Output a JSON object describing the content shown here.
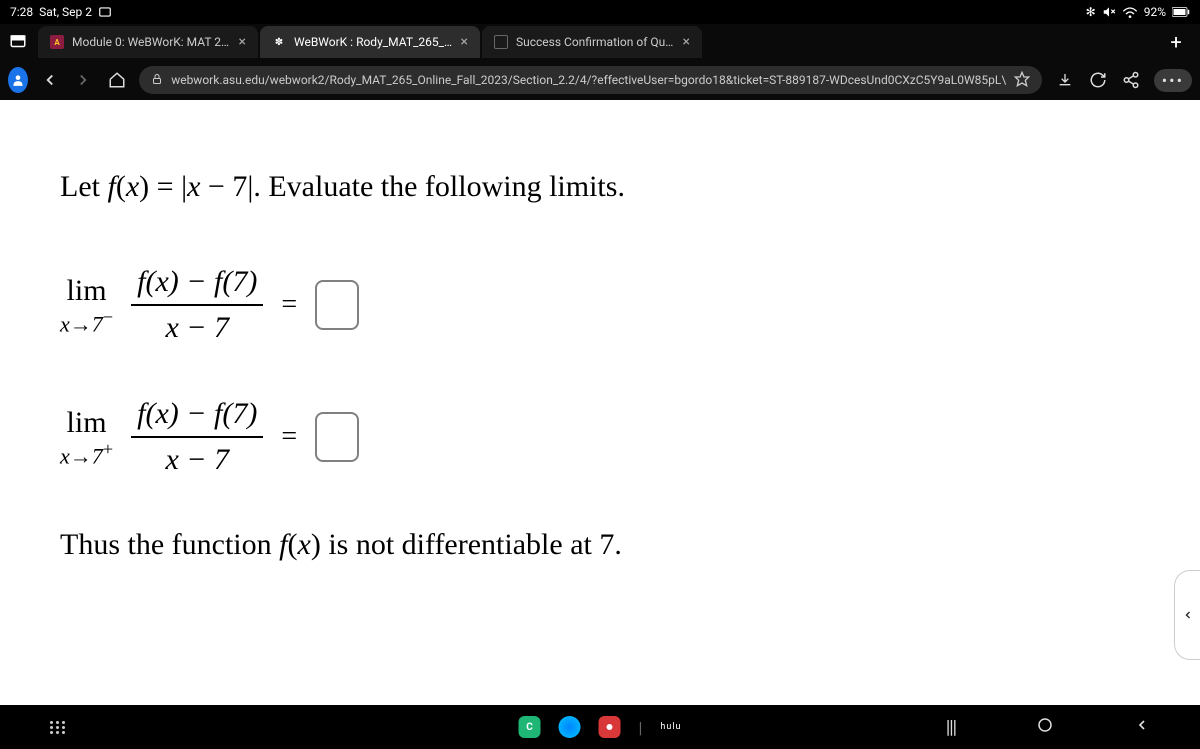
{
  "status": {
    "time": "7:28",
    "date": "Sat, Sep 2",
    "battery": "92%"
  },
  "tabs": [
    {
      "title": "Module 0: WeBWorK: MAT 265:",
      "active": false
    },
    {
      "title": "WeBWorK : Rody_MAT_265_Onl",
      "active": true
    },
    {
      "title": "Success Confirmation of Questi",
      "active": false
    }
  ],
  "url": "webwork.asu.edu/webwork2/Rody_MAT_265_Online_Fall_2023/Section_2.2/4/?effectiveUser=bgordo18&ticket=ST-889187-WDcesUnd0CXzC5Y9aL0W85pL\\",
  "problem": {
    "let_text": "Let ",
    "fx_def_pre": "f(x) = |x − 7|",
    "evaluate_text": ". Evaluate the following limits.",
    "lim_word": "lim",
    "approach_left": "x→7−",
    "approach_right": "x→7+",
    "frac_num": "f(x) − f(7)",
    "frac_den": "x − 7",
    "equals": "=",
    "conclusion_pre": "Thus the function ",
    "conclusion_fx": "f(x)",
    "conclusion_post": " is not differentiable at 7."
  },
  "dock": {
    "hulu": "hulu"
  }
}
